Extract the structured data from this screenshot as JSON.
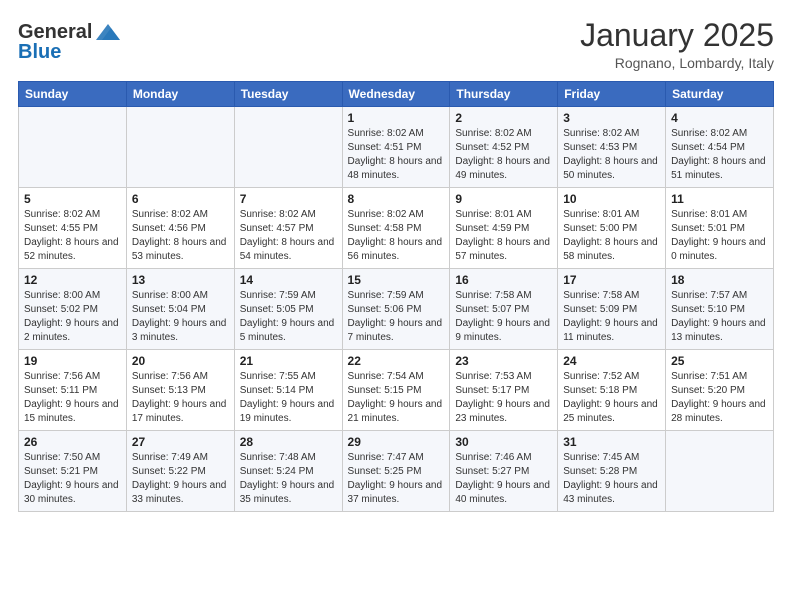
{
  "logo": {
    "general": "General",
    "blue": "Blue"
  },
  "header": {
    "month": "January 2025",
    "location": "Rognano, Lombardy, Italy"
  },
  "weekdays": [
    "Sunday",
    "Monday",
    "Tuesday",
    "Wednesday",
    "Thursday",
    "Friday",
    "Saturday"
  ],
  "weeks": [
    [
      {
        "day": "",
        "sunrise": "",
        "sunset": "",
        "daylight": ""
      },
      {
        "day": "",
        "sunrise": "",
        "sunset": "",
        "daylight": ""
      },
      {
        "day": "",
        "sunrise": "",
        "sunset": "",
        "daylight": ""
      },
      {
        "day": "1",
        "sunrise": "Sunrise: 8:02 AM",
        "sunset": "Sunset: 4:51 PM",
        "daylight": "Daylight: 8 hours and 48 minutes."
      },
      {
        "day": "2",
        "sunrise": "Sunrise: 8:02 AM",
        "sunset": "Sunset: 4:52 PM",
        "daylight": "Daylight: 8 hours and 49 minutes."
      },
      {
        "day": "3",
        "sunrise": "Sunrise: 8:02 AM",
        "sunset": "Sunset: 4:53 PM",
        "daylight": "Daylight: 8 hours and 50 minutes."
      },
      {
        "day": "4",
        "sunrise": "Sunrise: 8:02 AM",
        "sunset": "Sunset: 4:54 PM",
        "daylight": "Daylight: 8 hours and 51 minutes."
      }
    ],
    [
      {
        "day": "5",
        "sunrise": "Sunrise: 8:02 AM",
        "sunset": "Sunset: 4:55 PM",
        "daylight": "Daylight: 8 hours and 52 minutes."
      },
      {
        "day": "6",
        "sunrise": "Sunrise: 8:02 AM",
        "sunset": "Sunset: 4:56 PM",
        "daylight": "Daylight: 8 hours and 53 minutes."
      },
      {
        "day": "7",
        "sunrise": "Sunrise: 8:02 AM",
        "sunset": "Sunset: 4:57 PM",
        "daylight": "Daylight: 8 hours and 54 minutes."
      },
      {
        "day": "8",
        "sunrise": "Sunrise: 8:02 AM",
        "sunset": "Sunset: 4:58 PM",
        "daylight": "Daylight: 8 hours and 56 minutes."
      },
      {
        "day": "9",
        "sunrise": "Sunrise: 8:01 AM",
        "sunset": "Sunset: 4:59 PM",
        "daylight": "Daylight: 8 hours and 57 minutes."
      },
      {
        "day": "10",
        "sunrise": "Sunrise: 8:01 AM",
        "sunset": "Sunset: 5:00 PM",
        "daylight": "Daylight: 8 hours and 58 minutes."
      },
      {
        "day": "11",
        "sunrise": "Sunrise: 8:01 AM",
        "sunset": "Sunset: 5:01 PM",
        "daylight": "Daylight: 9 hours and 0 minutes."
      }
    ],
    [
      {
        "day": "12",
        "sunrise": "Sunrise: 8:00 AM",
        "sunset": "Sunset: 5:02 PM",
        "daylight": "Daylight: 9 hours and 2 minutes."
      },
      {
        "day": "13",
        "sunrise": "Sunrise: 8:00 AM",
        "sunset": "Sunset: 5:04 PM",
        "daylight": "Daylight: 9 hours and 3 minutes."
      },
      {
        "day": "14",
        "sunrise": "Sunrise: 7:59 AM",
        "sunset": "Sunset: 5:05 PM",
        "daylight": "Daylight: 9 hours and 5 minutes."
      },
      {
        "day": "15",
        "sunrise": "Sunrise: 7:59 AM",
        "sunset": "Sunset: 5:06 PM",
        "daylight": "Daylight: 9 hours and 7 minutes."
      },
      {
        "day": "16",
        "sunrise": "Sunrise: 7:58 AM",
        "sunset": "Sunset: 5:07 PM",
        "daylight": "Daylight: 9 hours and 9 minutes."
      },
      {
        "day": "17",
        "sunrise": "Sunrise: 7:58 AM",
        "sunset": "Sunset: 5:09 PM",
        "daylight": "Daylight: 9 hours and 11 minutes."
      },
      {
        "day": "18",
        "sunrise": "Sunrise: 7:57 AM",
        "sunset": "Sunset: 5:10 PM",
        "daylight": "Daylight: 9 hours and 13 minutes."
      }
    ],
    [
      {
        "day": "19",
        "sunrise": "Sunrise: 7:56 AM",
        "sunset": "Sunset: 5:11 PM",
        "daylight": "Daylight: 9 hours and 15 minutes."
      },
      {
        "day": "20",
        "sunrise": "Sunrise: 7:56 AM",
        "sunset": "Sunset: 5:13 PM",
        "daylight": "Daylight: 9 hours and 17 minutes."
      },
      {
        "day": "21",
        "sunrise": "Sunrise: 7:55 AM",
        "sunset": "Sunset: 5:14 PM",
        "daylight": "Daylight: 9 hours and 19 minutes."
      },
      {
        "day": "22",
        "sunrise": "Sunrise: 7:54 AM",
        "sunset": "Sunset: 5:15 PM",
        "daylight": "Daylight: 9 hours and 21 minutes."
      },
      {
        "day": "23",
        "sunrise": "Sunrise: 7:53 AM",
        "sunset": "Sunset: 5:17 PM",
        "daylight": "Daylight: 9 hours and 23 minutes."
      },
      {
        "day": "24",
        "sunrise": "Sunrise: 7:52 AM",
        "sunset": "Sunset: 5:18 PM",
        "daylight": "Daylight: 9 hours and 25 minutes."
      },
      {
        "day": "25",
        "sunrise": "Sunrise: 7:51 AM",
        "sunset": "Sunset: 5:20 PM",
        "daylight": "Daylight: 9 hours and 28 minutes."
      }
    ],
    [
      {
        "day": "26",
        "sunrise": "Sunrise: 7:50 AM",
        "sunset": "Sunset: 5:21 PM",
        "daylight": "Daylight: 9 hours and 30 minutes."
      },
      {
        "day": "27",
        "sunrise": "Sunrise: 7:49 AM",
        "sunset": "Sunset: 5:22 PM",
        "daylight": "Daylight: 9 hours and 33 minutes."
      },
      {
        "day": "28",
        "sunrise": "Sunrise: 7:48 AM",
        "sunset": "Sunset: 5:24 PM",
        "daylight": "Daylight: 9 hours and 35 minutes."
      },
      {
        "day": "29",
        "sunrise": "Sunrise: 7:47 AM",
        "sunset": "Sunset: 5:25 PM",
        "daylight": "Daylight: 9 hours and 37 minutes."
      },
      {
        "day": "30",
        "sunrise": "Sunrise: 7:46 AM",
        "sunset": "Sunset: 5:27 PM",
        "daylight": "Daylight: 9 hours and 40 minutes."
      },
      {
        "day": "31",
        "sunrise": "Sunrise: 7:45 AM",
        "sunset": "Sunset: 5:28 PM",
        "daylight": "Daylight: 9 hours and 43 minutes."
      },
      {
        "day": "",
        "sunrise": "",
        "sunset": "",
        "daylight": ""
      }
    ]
  ]
}
